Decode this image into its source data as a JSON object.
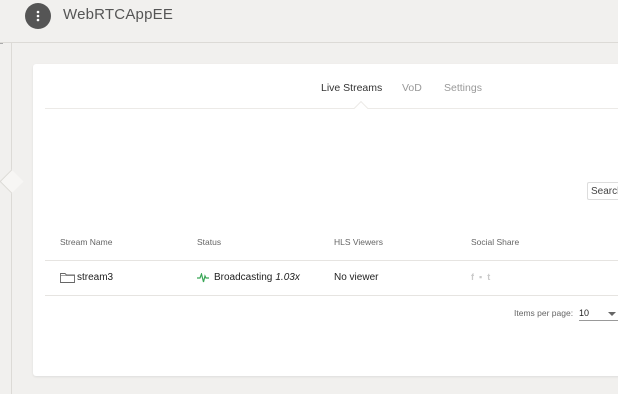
{
  "app": {
    "title": "WebRTCAppEE",
    "menu_icon": "more-vert-icon"
  },
  "tabs": [
    {
      "label": "Live Streams",
      "active": true
    },
    {
      "label": "VoD",
      "active": false
    },
    {
      "label": "Settings",
      "active": false
    }
  ],
  "search": {
    "placeholder": "Search"
  },
  "table": {
    "columns": [
      "Stream Name",
      "Status",
      "HLS Viewers",
      "Social Share"
    ],
    "rows": [
      {
        "stream_name": "stream3",
        "status": "Broadcasting",
        "speed": "1.03x",
        "hls_viewers": "No viewer",
        "social": {
          "facebook": "f",
          "youtube": "▪",
          "twitter": "t"
        }
      }
    ]
  },
  "pagination": {
    "items_per_page_label": "Items per page:",
    "items_per_page": "10"
  },
  "colors": {
    "status_green": "#3aa657",
    "icon_gray": "#c9c9c9",
    "menu_button": "#555555"
  }
}
